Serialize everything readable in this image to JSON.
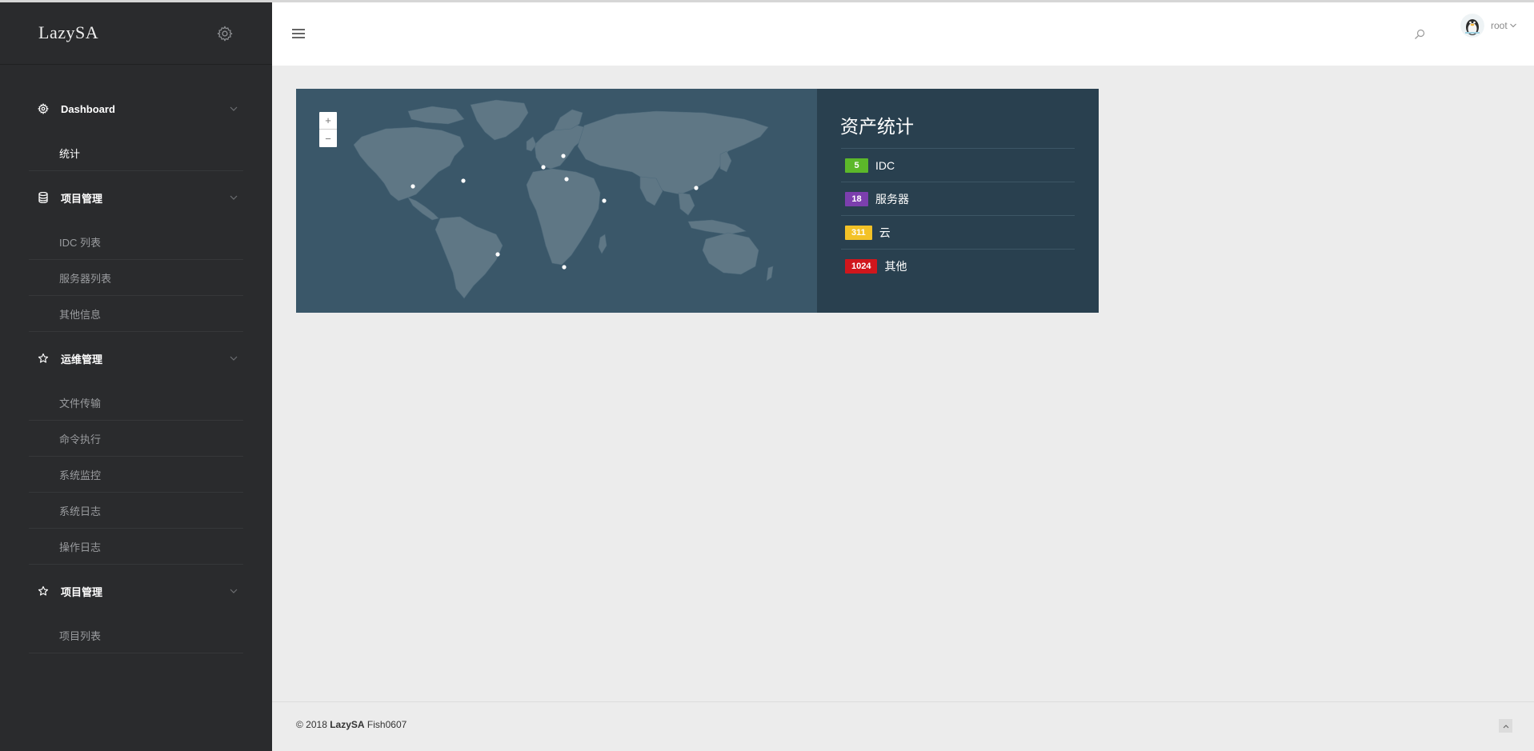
{
  "brand": {
    "name": "LazySA",
    "settings_icon": "gear-icon"
  },
  "sidebar": {
    "groups": [
      {
        "label": "Dashboard",
        "icon": "dashboard-gear-icon",
        "items": [
          {
            "label": "统计",
            "active": true
          }
        ]
      },
      {
        "label": "项目管理",
        "icon": "database-icon",
        "items": [
          {
            "label": "IDC 列表"
          },
          {
            "label": "服务器列表"
          },
          {
            "label": "其他信息"
          }
        ]
      },
      {
        "label": "运维管理",
        "icon": "star-icon",
        "items": [
          {
            "label": "文件传输"
          },
          {
            "label": "命令执行"
          },
          {
            "label": "系统监控"
          },
          {
            "label": "系统日志"
          },
          {
            "label": "操作日志"
          }
        ]
      },
      {
        "label": "项目管理",
        "icon": "star-icon",
        "items": [
          {
            "label": "项目列表"
          }
        ]
      }
    ]
  },
  "header": {
    "user": {
      "name": "root"
    }
  },
  "map": {
    "zoom_in_label": "+",
    "zoom_out_label": "−"
  },
  "stats": {
    "title": "资产统计",
    "rows": [
      {
        "count": "5",
        "label": "IDC",
        "color": "#5cb82a"
      },
      {
        "count": "18",
        "label": "服务器",
        "color": "#7c3fae"
      },
      {
        "count": "311",
        "label": "云",
        "color": "#f3c227"
      },
      {
        "count": "1024",
        "label": "其他",
        "color": "#d0161c"
      }
    ]
  },
  "footer": {
    "copyright": "© 2018",
    "brand": "LazySA",
    "author": "Fish0607"
  }
}
